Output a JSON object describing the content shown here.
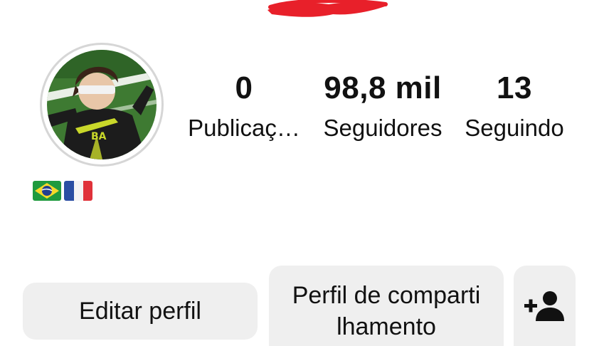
{
  "profile": {
    "avatar_alt": "profile picture",
    "bio_flags": [
      "brazil-flag",
      "france-flag"
    ]
  },
  "stats": {
    "posts_value": "0",
    "posts_label": "Publicaç…",
    "followers_value": "98,8 mil",
    "followers_label": "Seguidores",
    "following_value": "13",
    "following_label": "Seguindo"
  },
  "buttons": {
    "edit_label": "Editar perfil",
    "share_label": "Perfil de comparti lhamento",
    "add_icon": "person-add-icon"
  },
  "colors": {
    "redaction": "#e8202a",
    "button_bg": "#efefef",
    "avatar_ring": "#d6d6d6"
  }
}
